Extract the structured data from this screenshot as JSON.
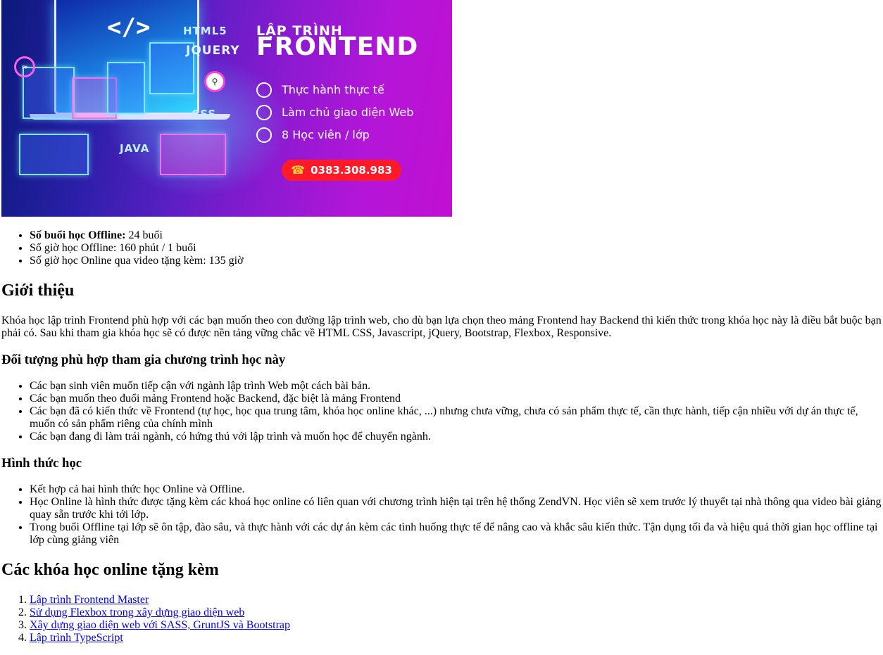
{
  "banner": {
    "code_glyph": "</>",
    "tech_labels": [
      "HTML5",
      "JQUERY",
      "CSS",
      "JAVA"
    ],
    "title_line1": "LẬP TRÌNH",
    "title_line2": "FRONTEND",
    "features": [
      {
        "icon": "code-icon",
        "label": "Thực hành thực tế"
      },
      {
        "icon": "web-layout-icon",
        "label": "Làm chủ giao diện Web"
      },
      {
        "icon": "students-icon",
        "label": "8 Học viên / lớp"
      }
    ],
    "phone": "0383.308.983",
    "colors": {
      "accent_pink": "#ff3fd6",
      "phone_bg": "#ff1a28",
      "cyan": "#34d7ff"
    }
  },
  "info": [
    {
      "label": "Số buổi học Offline:",
      "value": " 24 buổi"
    },
    {
      "text": "Số giờ học Offline: 160 phút / 1 buổi"
    },
    {
      "text": "Số giờ học Online qua video tặng kèm: 135 giờ"
    }
  ],
  "intro": {
    "heading": "Giới thiệu",
    "paragraph": "Khóa học lập trình Frontend phù hợp với các bạn muốn theo con đường lập trình web, cho dù bạn lựa chọn theo mảng Frontend hay Backend thì kiến thức trong khóa học này là điều bắt buộc bạn phải có. Sau khi tham gia khóa học sẽ có được nền tảng vững chắc về HTML CSS, Javascript, jQuery, Bootstrap, Flexbox, Responsive."
  },
  "audience": {
    "heading": "Đối tượng phù hợp tham gia chương trình học này",
    "items": [
      "Các bạn sinh viên muốn tiếp cận với ngành lập trình Web một cách bài bản.",
      "Các bạn muốn theo đuổi mảng Frontend hoặc Backend, đặc biệt là mảng Frontend",
      "Các bạn đã có kiến thức về Frontend (tự học, học qua trung tâm, khóa học online khác, ...) nhưng chưa vững, chưa có sản phẩm thực tế, cần thực hành, tiếp cận nhiều với dự án thực tế, muốn có sản phẩm riêng của chính mình",
      "Các bạn đang đi làm trái ngành, có hứng thú với lập trình và muốn học để chuyển ngành."
    ]
  },
  "format": {
    "heading": "Hình thức học",
    "items": [
      "Kết hợp cả hai hình thức học Online và Offline.",
      "Học Online là hình thức được tặng kèm các khoá học online có liên quan với chương trình hiện tại trên hệ thống ZendVN. Học viên sẽ xem trước lý thuyết tại nhà thông qua video bài giảng quay sẵn trước khi tới lớp.",
      "Trong buổi Offline tại lớp sẽ ôn tập, đào sâu, và thực hành với các dự án kèm các tình huống thực tế để nâng cao và khắc sâu kiến thức. Tận dụng tối đa và hiệu quả thời gian học offline tại lớp cùng giảng viên"
    ]
  },
  "bonus": {
    "heading": "Các khóa học online tặng kèm",
    "links": [
      "Lập trình Frontend Master",
      "Sử dụng Flexbox trong xây dựng giao diện web",
      "Xây dựng giao diện web với SASS, GruntJS và Bootstrap",
      "Lập trình TypeScript"
    ]
  }
}
